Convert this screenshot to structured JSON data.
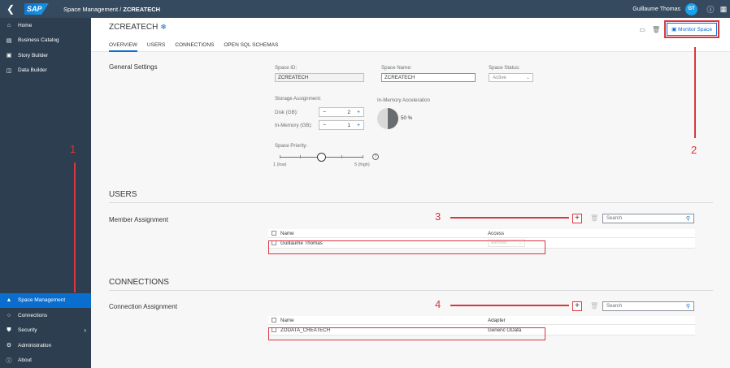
{
  "shell": {
    "back_icon": "back-icon",
    "logo": "SAP",
    "breadcrumb_parent": "Space Management / ",
    "breadcrumb_current": "ZCREATECH",
    "user_name": "Guillaume Thomas",
    "avatar_initials": "GT"
  },
  "sidebar": {
    "top_items": [
      {
        "label": "Home",
        "icon": "home-icon"
      },
      {
        "label": "Business Catalog",
        "icon": "catalog-icon"
      },
      {
        "label": "Story Builder",
        "icon": "story-icon"
      },
      {
        "label": "Data Builder",
        "icon": "data-builder-icon"
      }
    ],
    "bottom_items": [
      {
        "label": "Space Management",
        "icon": "space-icon",
        "active": true
      },
      {
        "label": "Connections",
        "icon": "connections-icon"
      },
      {
        "label": "Security",
        "icon": "security-icon"
      },
      {
        "label": "Administration",
        "icon": "admin-icon"
      },
      {
        "label": "About",
        "icon": "about-icon"
      }
    ]
  },
  "header": {
    "title": "ZCREATECH",
    "tabs": [
      "OVERVIEW",
      "USERS",
      "CONNECTIONS",
      "OPEN SQL SCHEMAS"
    ],
    "monitor_label": "Monitor Space"
  },
  "general": {
    "section_title": "General Settings",
    "space_id_label": "Space ID:",
    "space_id_value": "ZCREATECH",
    "space_name_label": "Space Name:",
    "space_name_value": "ZCREATECH",
    "space_status_label": "Space Status:",
    "space_status_value": "Active",
    "storage_label": "Storage Assignment:",
    "disk_label": "Disk (GB):",
    "disk_value": "2",
    "memory_label": "In-Memory (GB):",
    "memory_value": "1",
    "acceleration_label": "In-Memory Acceleration",
    "acceleration_value": "50 %",
    "acceleration_fraction": 0.5,
    "priority_label": "Space Priority:",
    "priority_min": "1 (low)",
    "priority_max": "5 (high)",
    "priority_value": 3
  },
  "users": {
    "heading": "USERS",
    "subheading": "Member Assignment",
    "search_placeholder": "Search",
    "col_name": "Name",
    "col_access": "Access",
    "rows": [
      {
        "name": "Guillaume Thomas",
        "access": "Member"
      }
    ]
  },
  "connections": {
    "heading": "CONNECTIONS",
    "subheading": "Connection Assignment",
    "search_placeholder": "Search",
    "col_name": "Name",
    "col_adapter": "Adapter",
    "rows": [
      {
        "name": "ZODATA_CREATECH",
        "adapter": "Generic OData"
      }
    ]
  },
  "annotations": [
    "1",
    "2",
    "3",
    "4"
  ],
  "colors": {
    "shell": "#354a5f",
    "sidebar": "#2c3e50",
    "accent": "#0a6ed1",
    "annotation": "#d9363e"
  }
}
